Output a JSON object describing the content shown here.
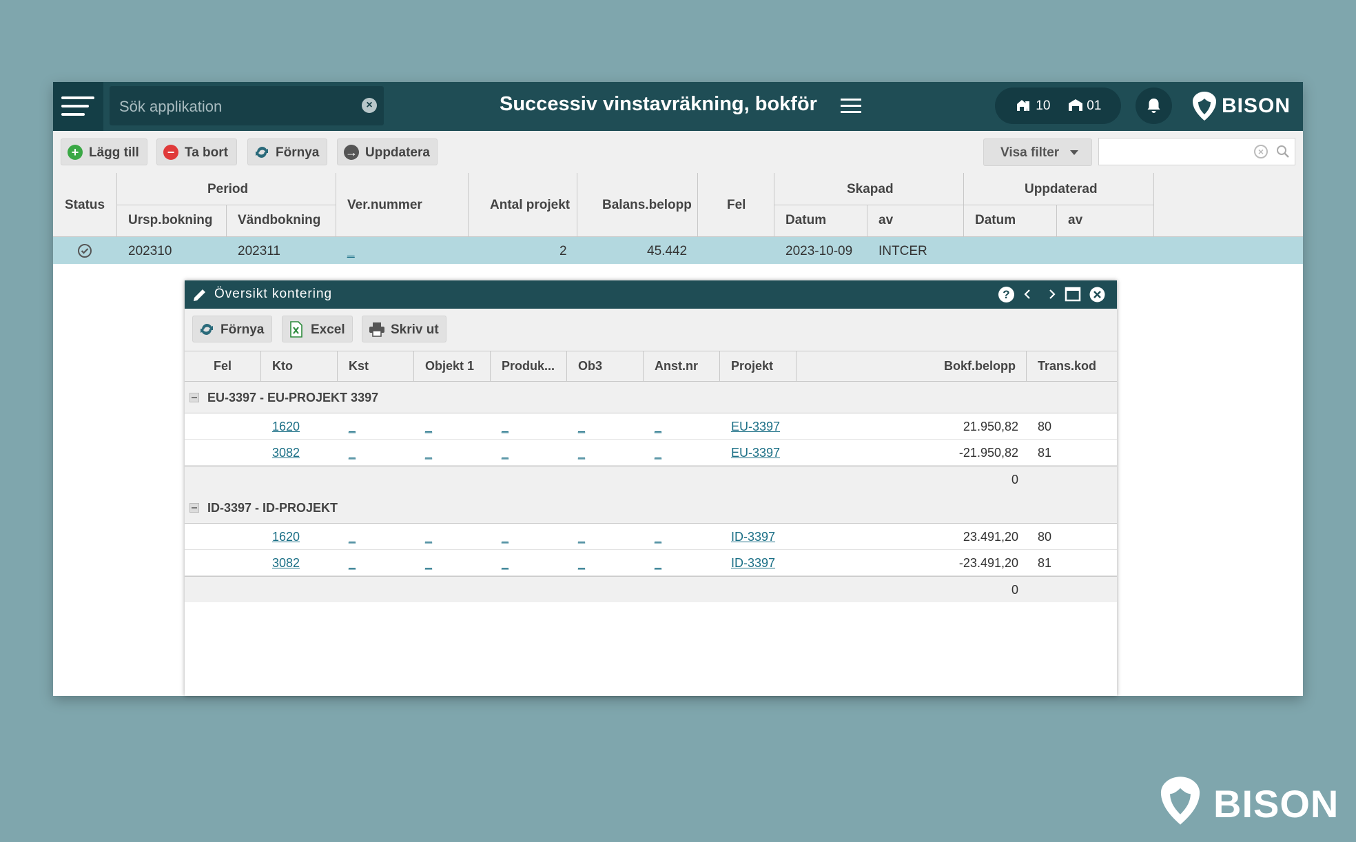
{
  "topbar": {
    "search_placeholder": "Sök applikation",
    "title": "Successiv vinstavräkning, bokför",
    "company_count": "10",
    "unit_count": "01",
    "logo_text": "BISON"
  },
  "toolbar": {
    "add": "Lägg till",
    "delete": "Ta bort",
    "refresh": "Förnya",
    "update": "Uppdatera",
    "show_filter": "Visa filter"
  },
  "grid": {
    "headers": {
      "status": "Status",
      "period": "Period",
      "ursp": "Ursp.bokning",
      "vand": "Vändbokning",
      "ver": "Ver.nummer",
      "antal": "Antal projekt",
      "balans": "Balans.belopp",
      "fel": "Fel",
      "skapad": "Skapad",
      "skapad_datum": "Datum",
      "skapad_av": "av",
      "uppdaterad": "Uppdaterad",
      "uppd_datum": "Datum",
      "uppd_av": "av"
    },
    "row": {
      "ursp": "202310",
      "vand": "202311",
      "ver": "_",
      "antal": "2",
      "balans": "45.442",
      "datum": "2023-10-09",
      "av": "INTCER"
    }
  },
  "dialog": {
    "title": "Översikt kontering",
    "buttons": {
      "refresh": "Förnya",
      "excel": "Excel",
      "print": "Skriv ut"
    },
    "headers": {
      "fel": "Fel",
      "kto": "Kto",
      "kst": "Kst",
      "objekt1": "Objekt 1",
      "produkt": "Produk...",
      "ob3": "Ob3",
      "anst": "Anst.nr",
      "projekt": "Projekt",
      "belopp": "Bokf.belopp",
      "transkod": "Trans.kod"
    },
    "groups": [
      {
        "label": "EU-3397 - EU-PROJEKT 3397",
        "rows": [
          {
            "kto": "1620",
            "projekt": "EU-3397",
            "belopp": "21.950,82",
            "kod": "80"
          },
          {
            "kto": "3082",
            "projekt": "EU-3397",
            "belopp": "-21.950,82",
            "kod": "81"
          }
        ],
        "sum": "0"
      },
      {
        "label": "ID-3397 - ID-PROJEKT",
        "rows": [
          {
            "kto": "1620",
            "projekt": "ID-3397",
            "belopp": "23.491,20",
            "kod": "80"
          },
          {
            "kto": "3082",
            "projekt": "ID-3397",
            "belopp": "-23.491,20",
            "kod": "81"
          }
        ],
        "sum": "0"
      }
    ],
    "empty_link": "_"
  },
  "corner_logo": "BISON",
  "colors": {
    "header": "#1f4d55",
    "selected_row": "#b3d8df",
    "background": "#7fa6ad",
    "link": "#1b6f86"
  }
}
